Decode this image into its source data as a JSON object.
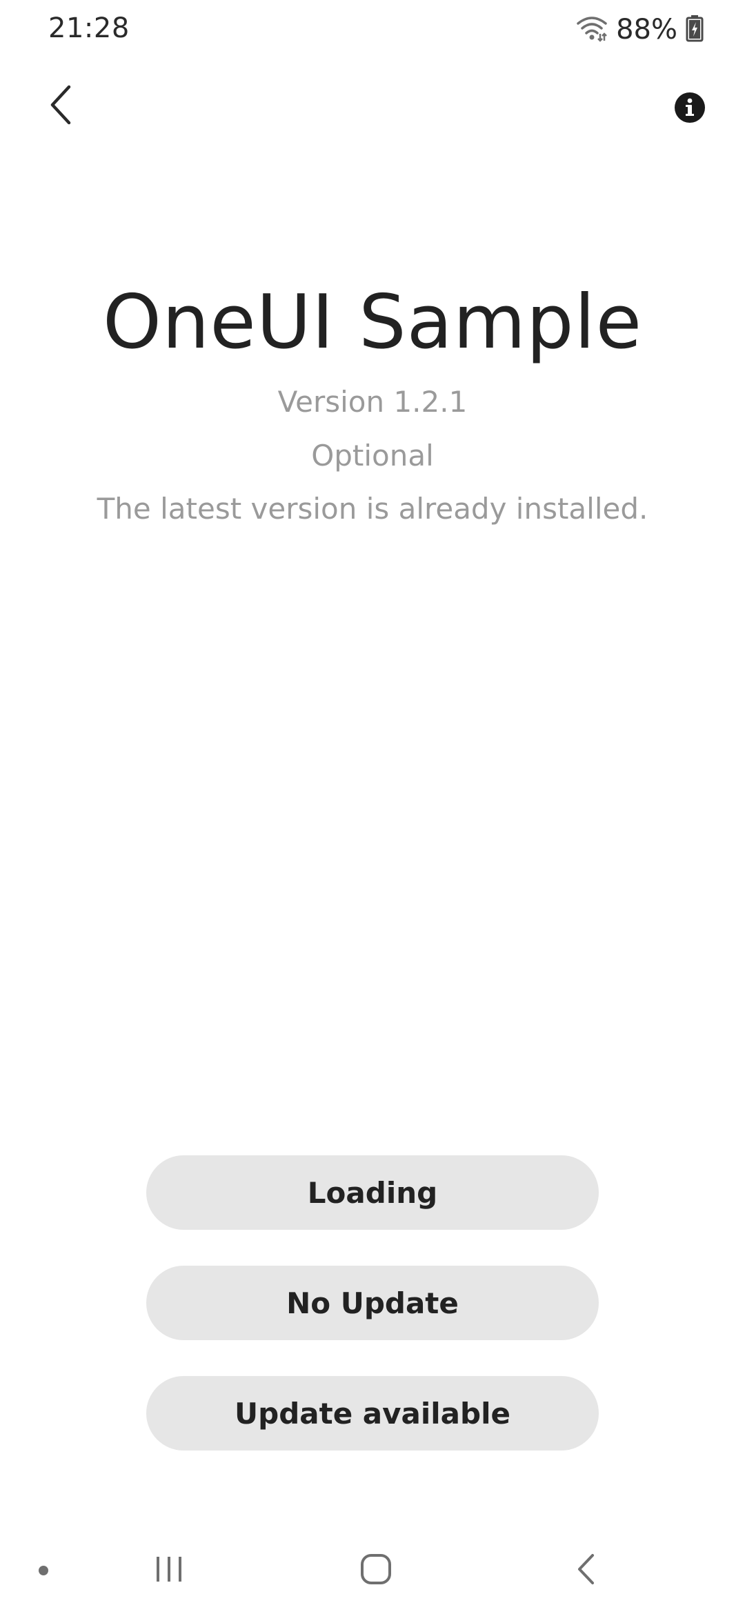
{
  "status_bar": {
    "time": "21:28",
    "battery_percent": "88%",
    "icons": [
      "wifi-icon",
      "battery-charging-icon"
    ]
  },
  "app_bar": {
    "back_icon": "chevron-left-icon",
    "info_icon": "info-icon"
  },
  "main": {
    "title": "OneUI Sample",
    "version": "Version 1.2.1",
    "update_type": "Optional",
    "status_message": "The latest version is already installed."
  },
  "buttons": {
    "loading_label": "Loading",
    "no_update_label": "No Update",
    "update_available_label": "Update available"
  },
  "nav_bar": {
    "icons": [
      "recents-icon",
      "home-icon",
      "back-icon"
    ]
  },
  "colors": {
    "button_background": "#e6e6e6",
    "secondary_text": "#9a9a9a",
    "primary_text": "#222222"
  }
}
